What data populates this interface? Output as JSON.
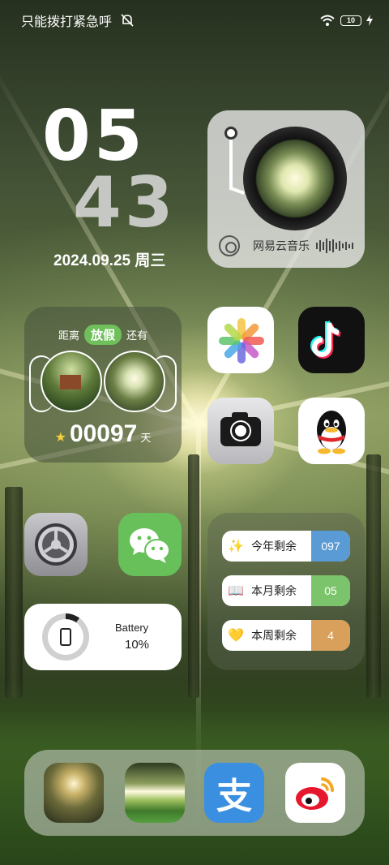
{
  "status_bar": {
    "carrier_text": "只能拨打紧急呼",
    "mute_icon": "bell-off-icon",
    "wifi_icon": "wifi-icon",
    "battery_level": "10",
    "charging_icon": "lightning-icon"
  },
  "clock": {
    "hour": "05",
    "minute": "43",
    "date": "2024.09.25 周三"
  },
  "music_widget": {
    "app_name": "网易云音乐",
    "icon": "netease-music-icon"
  },
  "holiday_widget": {
    "prefix": "距离",
    "holiday_label": "放假",
    "suffix": "还有",
    "days": "00097",
    "unit": "天"
  },
  "apps": {
    "photos": "photos-icon",
    "tiktok": "tiktok-icon",
    "camera": "camera-icon",
    "qq": "qq-icon",
    "settings": "settings-icon",
    "wechat": "wechat-icon"
  },
  "battery_widget": {
    "label": "Battery",
    "value": "10%",
    "level_fraction": 0.1
  },
  "countdown_widget": {
    "rows": [
      {
        "emoji": "✨",
        "label": "今年剩余",
        "value": "097",
        "color": "#5b9bd5"
      },
      {
        "emoji": "📖",
        "label": "本月剩余",
        "value": "05",
        "color": "#7cc46b"
      },
      {
        "emoji": "💛",
        "label": "本周剩余",
        "value": "4",
        "color": "#d9a05b"
      }
    ]
  },
  "dock": {
    "items": [
      "forest-photo-1",
      "forest-photo-2",
      "alipay-icon",
      "weibo-icon"
    ],
    "alipay_glyph": "支"
  }
}
